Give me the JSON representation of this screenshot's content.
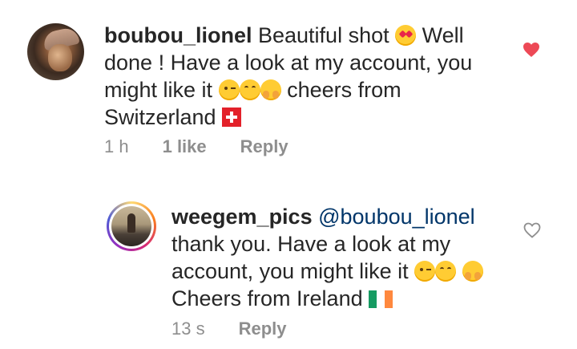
{
  "comments": [
    {
      "username": "boubou_lionel",
      "text_parts": [
        "Beautiful shot",
        "Well done ! Have a look at my account, you might like it",
        "cheers from Switzerland"
      ],
      "time": "1 h",
      "likes": "1 like",
      "reply": "Reply",
      "liked": true,
      "like_color": "#ed4956"
    },
    {
      "username": "weegem_pics",
      "mention": "@boubou_lionel",
      "text_parts": [
        "thank you. Have a look at my account, you might like it",
        "Cheers from Ireland"
      ],
      "time": "13 s",
      "reply": "Reply",
      "liked": false,
      "like_color": "#8e8e8e"
    }
  ],
  "colors": {
    "text": "#262626",
    "muted": "#8e8e8e",
    "mention": "#003569",
    "like_active": "#ed4956"
  }
}
